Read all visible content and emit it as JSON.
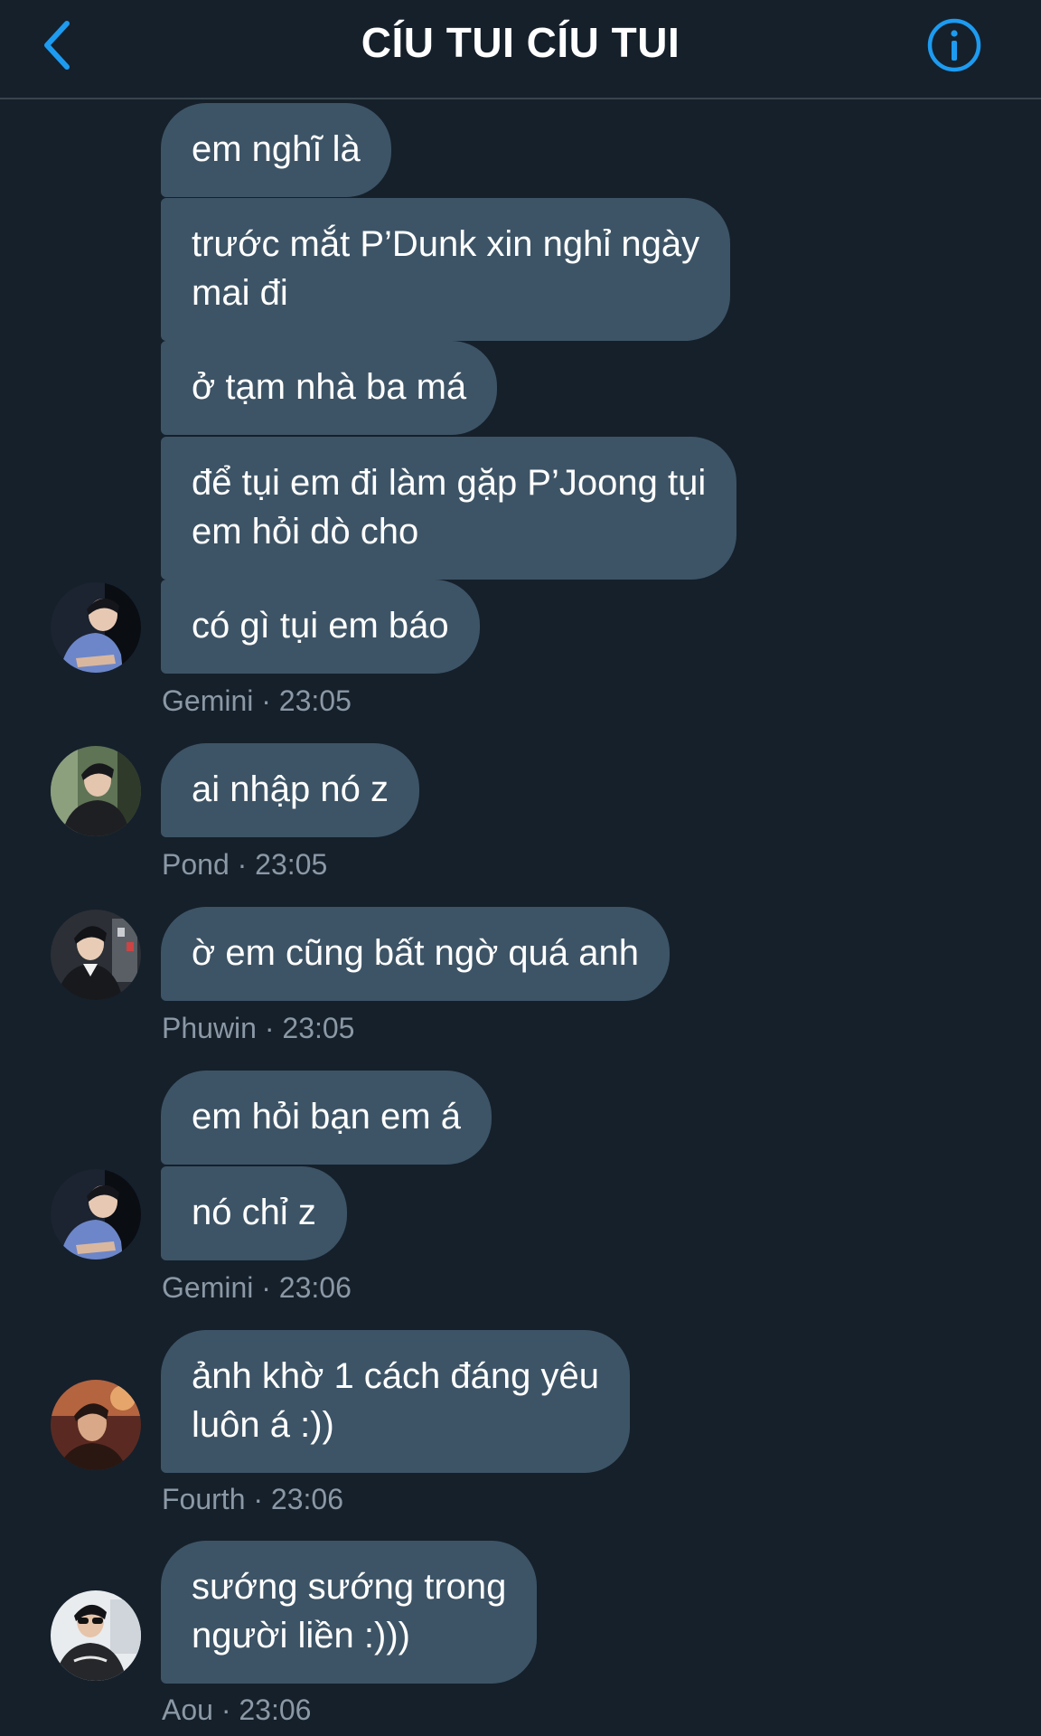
{
  "header": {
    "title": "CÍU TUI CÍU TUI",
    "back_icon": "chevron-left-icon",
    "info_icon": "info-icon",
    "accent_color": "#1d9bf0"
  },
  "colors": {
    "background": "#15202b",
    "bubble": "#3d5466",
    "meta_text": "#8b98a5"
  },
  "messages": [
    {
      "text": "em nghĩ là"
    },
    {
      "text": "trước mắt P’Dunk xin nghỉ ngày\nmai đi"
    },
    {
      "text": "ở tạm nhà ba má"
    },
    {
      "text": "để tụi em đi làm gặp P’Joong tụi\nem hỏi dò cho"
    },
    {
      "text": "có gì tụi em báo",
      "meta": "Gemini · 23:05"
    },
    {
      "text": "ai nhập nó z",
      "meta": "Pond · 23:05"
    },
    {
      "text": "ờ em cũng bất ngờ quá anh",
      "meta": "Phuwin · 23:05"
    },
    {
      "text": "em hỏi bạn em á"
    },
    {
      "text": "nó chỉ z",
      "meta": "Gemini · 23:06"
    },
    {
      "text": "ảnh khờ 1 cách đáng yêu\nluôn á :))",
      "meta": "Fourth · 23:06"
    },
    {
      "text": "sướng sướng trong\nngười liền :)))",
      "meta": "Aou · 23:06"
    }
  ]
}
